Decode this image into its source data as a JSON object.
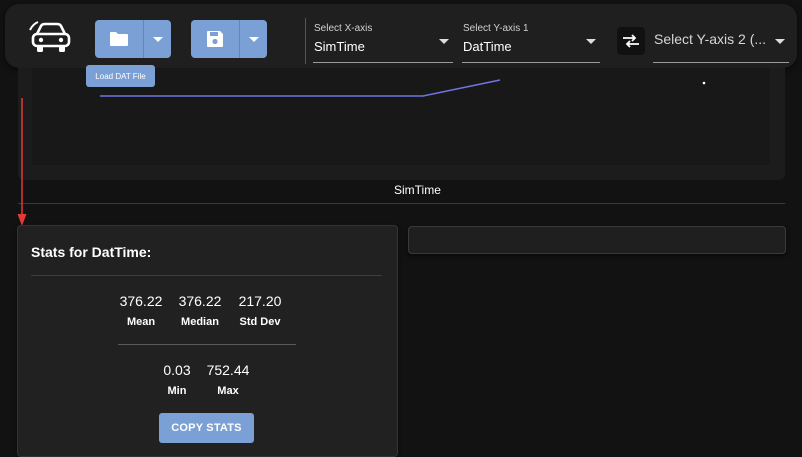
{
  "toolbar": {
    "logo_icon": "car-logo-icon",
    "load_button_icon": "folder-icon",
    "save_button_icon": "save-icon",
    "load_tooltip": "Load DAT File",
    "x_axis": {
      "label": "Select X-axis",
      "value": "SimTime"
    },
    "y_axis_1": {
      "label": "Select Y-axis 1",
      "value": "DatTime"
    },
    "swap_icon": "swap-arrows-icon",
    "y_axis_2": {
      "placeholder": "Select Y-axis 2 (..."
    }
  },
  "chart": {
    "xlabel": "SimTime",
    "series_color": "#6f74e0"
  },
  "stats": {
    "title": "Stats for DatTime:",
    "mean": {
      "value": "376.22",
      "label": "Mean"
    },
    "median": {
      "value": "376.22",
      "label": "Median"
    },
    "std_dev": {
      "value": "217.20",
      "label": "Std Dev"
    },
    "min": {
      "value": "0.03",
      "label": "Min"
    },
    "max": {
      "value": "752.44",
      "label": "Max"
    },
    "copy_label": "COPY STATS"
  },
  "colors": {
    "accent": "#7aa0d6",
    "annotation_arrow": "#e53935"
  }
}
